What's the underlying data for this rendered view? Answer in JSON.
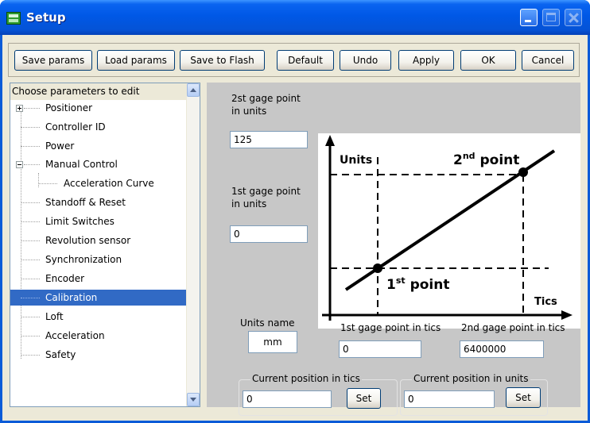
{
  "window": {
    "title": "Setup"
  },
  "toolbar": {
    "save_params": "Save params",
    "load_params": "Load params",
    "save_to_flash": "Save to Flash",
    "default": "Default",
    "undo": "Undo",
    "apply": "Apply",
    "ok": "OK",
    "cancel": "Cancel"
  },
  "tree": {
    "header": "Choose parameters to edit",
    "items": [
      {
        "label": "Positioner",
        "level": 0,
        "expander": "plus"
      },
      {
        "label": "Controller ID",
        "level": 0
      },
      {
        "label": "Power",
        "level": 0
      },
      {
        "label": "Manual Control",
        "level": 0,
        "expander": "minus"
      },
      {
        "label": "Acceleration Curve",
        "level": 1
      },
      {
        "label": "Standoff & Reset",
        "level": 0
      },
      {
        "label": "Limit Switches",
        "level": 0
      },
      {
        "label": "Revolution sensor",
        "level": 0
      },
      {
        "label": "Synchronization",
        "level": 0
      },
      {
        "label": "Encoder",
        "level": 0
      },
      {
        "label": "Calibration",
        "level": 0,
        "selected": true
      },
      {
        "label": "Loft",
        "level": 0
      },
      {
        "label": "Acceleration",
        "level": 0
      },
      {
        "label": "Safety",
        "level": 0
      }
    ]
  },
  "calibration": {
    "second_gage_units_label_1": "2st gage point",
    "second_gage_units_label_2": "in units",
    "second_gage_units_value": "125",
    "first_gage_units_label_1": "1st gage point",
    "first_gage_units_label_2": "in units",
    "first_gage_units_value": "0",
    "units_name_label": "Units name",
    "units_name_value": "mm",
    "first_gage_tics_label": "1st gage point in tics",
    "first_gage_tics_value": "0",
    "second_gage_tics_label": "2nd gage point in tics",
    "second_gage_tics_value": "6400000",
    "current_tics_label": "Current position in tics",
    "current_tics_value": "0",
    "current_units_label": "Current position in units",
    "current_units_value": "0",
    "set_label": "Set"
  },
  "diagram": {
    "y_axis_label": "Units",
    "x_axis_label": "Tics",
    "point2_label_prefix": "2",
    "point2_label_sup": "nd",
    "point2_label_suffix": " point",
    "point1_label_prefix": "1",
    "point1_label_sup": "st",
    "point1_label_suffix": " point"
  }
}
